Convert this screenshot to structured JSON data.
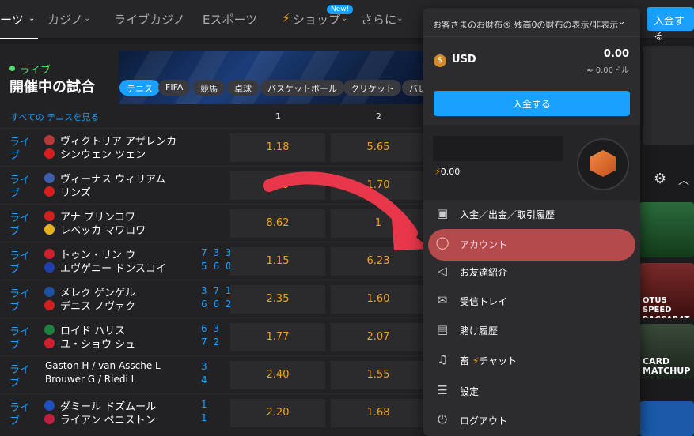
{
  "nav": {
    "items": [
      "ーツ",
      "カジノ",
      "ライブカジノ",
      "Eスポーツ",
      "ショップ",
      "さらに"
    ],
    "new_badge": "New!",
    "deposit": "入金する"
  },
  "live_section": {
    "live_label": "ライブ",
    "title": "開催中の試合",
    "chips": [
      "テニス",
      "FIFA",
      "競馬",
      "卓球",
      "バスケットボール",
      "クリケット",
      "バレ"
    ],
    "see_all": "すべての テニスを見る",
    "col_1": "1",
    "col_2": "2",
    "live_word": [
      "ライ",
      "ブ"
    ]
  },
  "matches": [
    {
      "p1": "ヴィクトリア アザレンカ",
      "p2": "シンウェン ツェン",
      "s1": "",
      "s2": "",
      "o1": "1.18",
      "o2": "5.65",
      "f1": "#b53a3a",
      "f2": "#d62020"
    },
    {
      "p1": "ヴィーナス ウィリアム",
      "p2": "リンズ",
      "s1": "",
      "s2": "",
      "o1": "2.19",
      "o2": "1.70",
      "f1": "#3c5fb0",
      "f2": "#d62020"
    },
    {
      "p1": "アナ ブリンコワ",
      "p2": "レベッカ マワロワ",
      "s1": "",
      "s2": "",
      "o1": "8.62",
      "o2": "1",
      "f1": "#d02020",
      "f2": "#e8b020"
    },
    {
      "p1": "トゥン・リン ウ",
      "p2": "エヴゲニー ドンスコイ",
      "s1": "7 3 3",
      "s2": "5 6 0",
      "o1": "1.15",
      "o2": "6.23",
      "f1": "#d02030",
      "f2": "#2040b0"
    },
    {
      "p1": "メレク ゲンゲル",
      "p2": "デニス ノヴァク",
      "s1": "3 7 1",
      "s2": "6 6 2",
      "o1": "2.35",
      "o2": "1.60",
      "f1": "#2050a0",
      "f2": "#d02020"
    },
    {
      "p1": "ロイド ハリス",
      "p2": "ユ・ショウ シュ",
      "s1": "6 3",
      "s2": "7 2",
      "o1": "1.77",
      "o2": "2.07",
      "f1": "#208040",
      "f2": "#d02030"
    },
    {
      "p1": "Gaston H / van Assche L",
      "p2": "Brouwer G / Riedi L",
      "s1": "3",
      "s2": "4",
      "o1": "2.40",
      "o2": "1.55",
      "f1": "",
      "f2": ""
    },
    {
      "p1": "ダミール ドズムール",
      "p2": "ライアン ペニストン",
      "s1": "1",
      "s2": "1",
      "o1": "2.20",
      "o2": "1.68",
      "f1": "#2050c0",
      "f2": "#c02040"
    }
  ],
  "wallet": {
    "header": "お客さまのお財布® 残高0の財布の表示/非表示",
    "currency": "USD",
    "balance": "0.00",
    "balance_sub": "≈ 0.00ドル",
    "deposit": "入金する",
    "points": "0.00"
  },
  "menu": [
    {
      "label": "入金／出金／取引履歴",
      "icon": "wallet-icon"
    },
    {
      "label": "アカウント",
      "icon": "user-icon"
    },
    {
      "label": "お友達紹介",
      "icon": "megaphone-icon"
    },
    {
      "label": "受信トレイ",
      "icon": "mail-icon"
    },
    {
      "label": "賭け履歴",
      "icon": "receipt-icon"
    },
    {
      "label": "チャット",
      "prefix": "畜",
      "icon": "headset-icon"
    },
    {
      "label": "設定",
      "icon": "sliders-icon"
    },
    {
      "label": "ログアウト",
      "icon": "power-icon"
    }
  ],
  "side_thumbs": [
    {
      "caption": "",
      "color": "#1b5a2a"
    },
    {
      "caption": "OTUS SPEED BACCARAT",
      "color": "#6a1a1a"
    },
    {
      "caption": "CARD MATCHUP",
      "color": "#2a3a2a"
    }
  ],
  "colors": {
    "accent": "#1aa0ff",
    "odds": "#f0a020",
    "highlight": "#b44a4c",
    "live_green": "#4fdc6a"
  }
}
